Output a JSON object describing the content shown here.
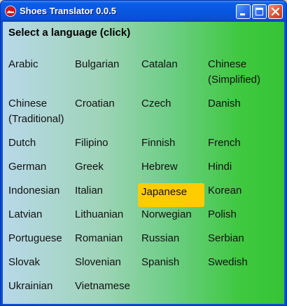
{
  "window": {
    "title": "Shoes Translator 0.0.5",
    "accent": "#0a4fd8"
  },
  "main": {
    "heading": "Select a language (click)",
    "selected_color": "#ffcc00",
    "languages": [
      {
        "label": "Arabic"
      },
      {
        "label": "Bulgarian"
      },
      {
        "label": "Catalan"
      },
      {
        "label": "Chinese",
        "label2": "(Simplified)"
      },
      {
        "label": "Chinese",
        "label2": "(Traditional)"
      },
      {
        "label": "Croatian"
      },
      {
        "label": "Czech"
      },
      {
        "label": "Danish"
      },
      {
        "label": "Dutch"
      },
      {
        "label": "Filipino"
      },
      {
        "label": "Finnish"
      },
      {
        "label": "French"
      },
      {
        "label": "German"
      },
      {
        "label": "Greek"
      },
      {
        "label": "Hebrew"
      },
      {
        "label": "Hindi"
      },
      {
        "label": "Indonesian"
      },
      {
        "label": "Italian"
      },
      {
        "label": "Japanese",
        "selected": true
      },
      {
        "label": "Korean"
      },
      {
        "label": "Latvian"
      },
      {
        "label": "Lithuanian"
      },
      {
        "label": "Norwegian"
      },
      {
        "label": "Polish"
      },
      {
        "label": "Portuguese"
      },
      {
        "label": "Romanian"
      },
      {
        "label": "Russian"
      },
      {
        "label": "Serbian"
      },
      {
        "label": "Slovak"
      },
      {
        "label": "Slovenian"
      },
      {
        "label": "Spanish"
      },
      {
        "label": "Swedish"
      },
      {
        "label": "Ukrainian"
      },
      {
        "label": "Vietnamese"
      }
    ]
  }
}
